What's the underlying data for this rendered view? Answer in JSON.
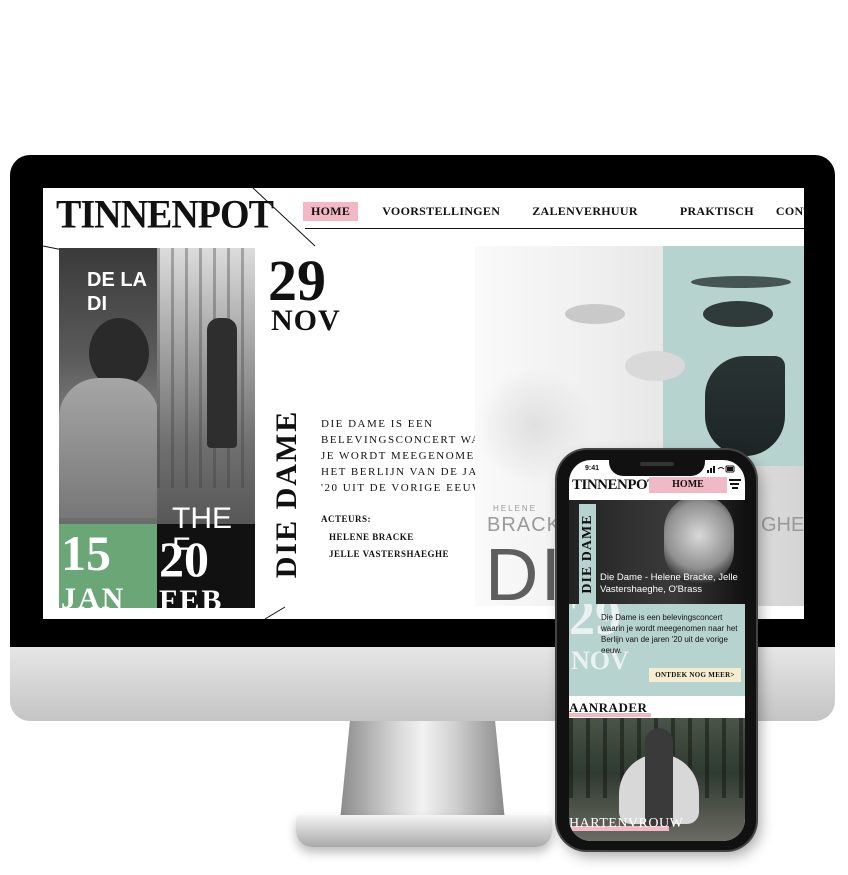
{
  "desktop": {
    "logo": "TINNENPOT",
    "nav": [
      "HOME",
      "VOORSTELLINGEN",
      "ZALENVERHUUR",
      "PRAKTISCH",
      "CONTACT"
    ],
    "posters": [
      {
        "title": "DE LA\nDI",
        "day": "15",
        "month": "JAN",
        "accent": "#6aa676"
      },
      {
        "title": "THE F",
        "day": "20",
        "month": "FEB",
        "accent": "#111111"
      }
    ],
    "hero": {
      "day": "29",
      "month": "NOV",
      "title": "DIE DAME",
      "description": "DIE DAME IS EEN BELEVINGSCONCERT WAARIN JE WORDT MEEGENOMEN NAAR HET BERLIJN VAN DE JAREN '20 UIT DE VORIGE EEUW.",
      "actors_label": "ACTEURS:",
      "actors": [
        "HELENE BRACKE",
        "JELLE VASTERSHAEGHE"
      ],
      "image_caption_small": "HELENE",
      "image_caption_mid": "BRACKE O",
      "image_caption_right": "GHE",
      "image_caption_big": "DIE"
    }
  },
  "phone": {
    "time": "9:41",
    "status_icons": "signal-wifi-battery",
    "logo": "TINNENPOT",
    "nav_active": "HOME",
    "hero_vertical": "DIE DAME",
    "hero_title": "Die Dame - Helene Bracke, Jelle Vastershaeghe, O'Brass",
    "info_day": "29",
    "info_month": "NOV",
    "info_text": "Die Dame is een belevingsconcert waarin je wordt meegenomen naar het Berlijn van de jaren '20 uit de vorige eeuw.",
    "cta": "ONTDEK NOG MEER>",
    "section_title": "AANRADER",
    "pic_title": "HARTENVROUW"
  },
  "colors": {
    "accent_pink": "#f2b8c6",
    "accent_teal": "#b7d3d0",
    "accent_green": "#6aa676",
    "cta_cream": "#f6eccf"
  }
}
